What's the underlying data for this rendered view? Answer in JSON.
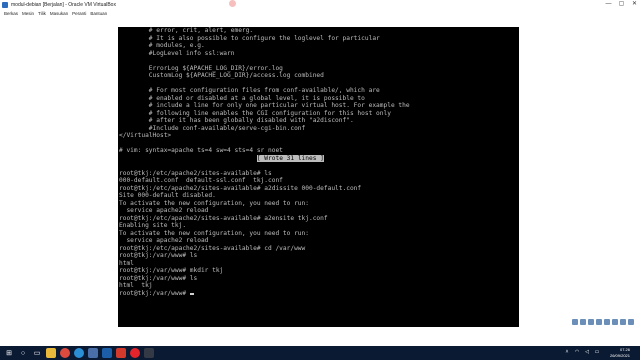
{
  "window": {
    "title": "modul-debian [Berjalan] - Oracle VM VirtualBox",
    "controls": [
      "—",
      "▢",
      "✕"
    ]
  },
  "menu": [
    "Berkas",
    "Mesin",
    "Tilik",
    "Masukan",
    "Peranti",
    "Bantuan"
  ],
  "terminal": {
    "lines": [
      "        # error, crit, alert, emerg.",
      "        # It is also possible to configure the loglevel for particular",
      "        # modules, e.g.",
      "        #LogLevel info ssl:warn",
      "",
      "        ErrorLog ${APACHE_LOG_DIR}/error.log",
      "        CustomLog ${APACHE_LOG_DIR}/access.log combined",
      "",
      "        # For most configuration files from conf-available/, which are",
      "        # enabled or disabled at a global level, it is possible to",
      "        # include a line for only one particular virtual host. For example the",
      "        # following line enables the CGI configuration for this host only",
      "        # after it has been globally disabled with \"a2disconf\".",
      "        #Include conf-available/serve-cgi-bin.conf",
      "</VirtualHost>",
      "",
      "# vim: syntax=apache ts=4 sw=4 sts=4 sr noet",
      "",
      "root@tkj:/etc/apache2/sites-available# ls",
      "000-default.conf  default-ssl.conf  tkj.conf",
      "root@tkj:/etc/apache2/sites-available# a2dissite 000-default.conf",
      "Site 000-default disabled.",
      "To activate the new configuration, you need to run:",
      "  service apache2 reload",
      "root@tkj:/etc/apache2/sites-available# a2ensite tkj.conf",
      "Enabling site tkj.",
      "To activate the new configuration, you need to run:",
      "  service apache2 reload",
      "root@tkj:/etc/apache2/sites-available# cd /var/www",
      "root@tkj:/var/www# ls",
      "html",
      "root@tkj:/var/www# mkdir tkj",
      "root@tkj:/var/www# ls",
      "html  tkj",
      "root@tkj:/var/www# "
    ],
    "status_message": "[ Wrote 31 lines ]"
  },
  "clock": {
    "time": "07.26",
    "date": "26/09/2021"
  },
  "colors": {
    "terminal_bg": "#000000",
    "terminal_fg": "#bdbdbd",
    "taskbar": "#0b1a33"
  },
  "taskbar_icons": [
    "windows-start-icon",
    "search-icon",
    "task-view-icon",
    "file-explorer-icon",
    "chrome-icon",
    "edge-icon",
    "store-icon",
    "virtualbox-icon",
    "media-icon",
    "opera-icon",
    "terminal-icon"
  ]
}
